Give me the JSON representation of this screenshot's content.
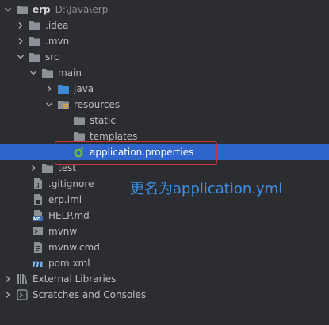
{
  "project": {
    "name": "erp",
    "path": "D:\\Java\\erp"
  },
  "items": {
    "idea": ".idea",
    "mvn": ".mvn",
    "src": "src",
    "main": "main",
    "java": "java",
    "resources": "resources",
    "static": "static",
    "templates": "templates",
    "application_properties": "application.properties",
    "test": "test",
    "gitignore": ".gitignore",
    "erp_iml": "erp.iml",
    "help_md": "HELP.md",
    "mvnw": "mvnw",
    "mvnw_cmd": "mvnw.cmd",
    "pom_xml": "pom.xml",
    "external_libraries": "External Libraries",
    "scratches": "Scratches and Consoles"
  },
  "annotation": {
    "text": "更名为application.yml",
    "color": "#3d8fe8",
    "box_color": "#c83a3a"
  },
  "colors": {
    "background": "#2b2d30",
    "selection": "#2f65ca",
    "folder": "#8c9197",
    "text": "#bbbdc0"
  }
}
